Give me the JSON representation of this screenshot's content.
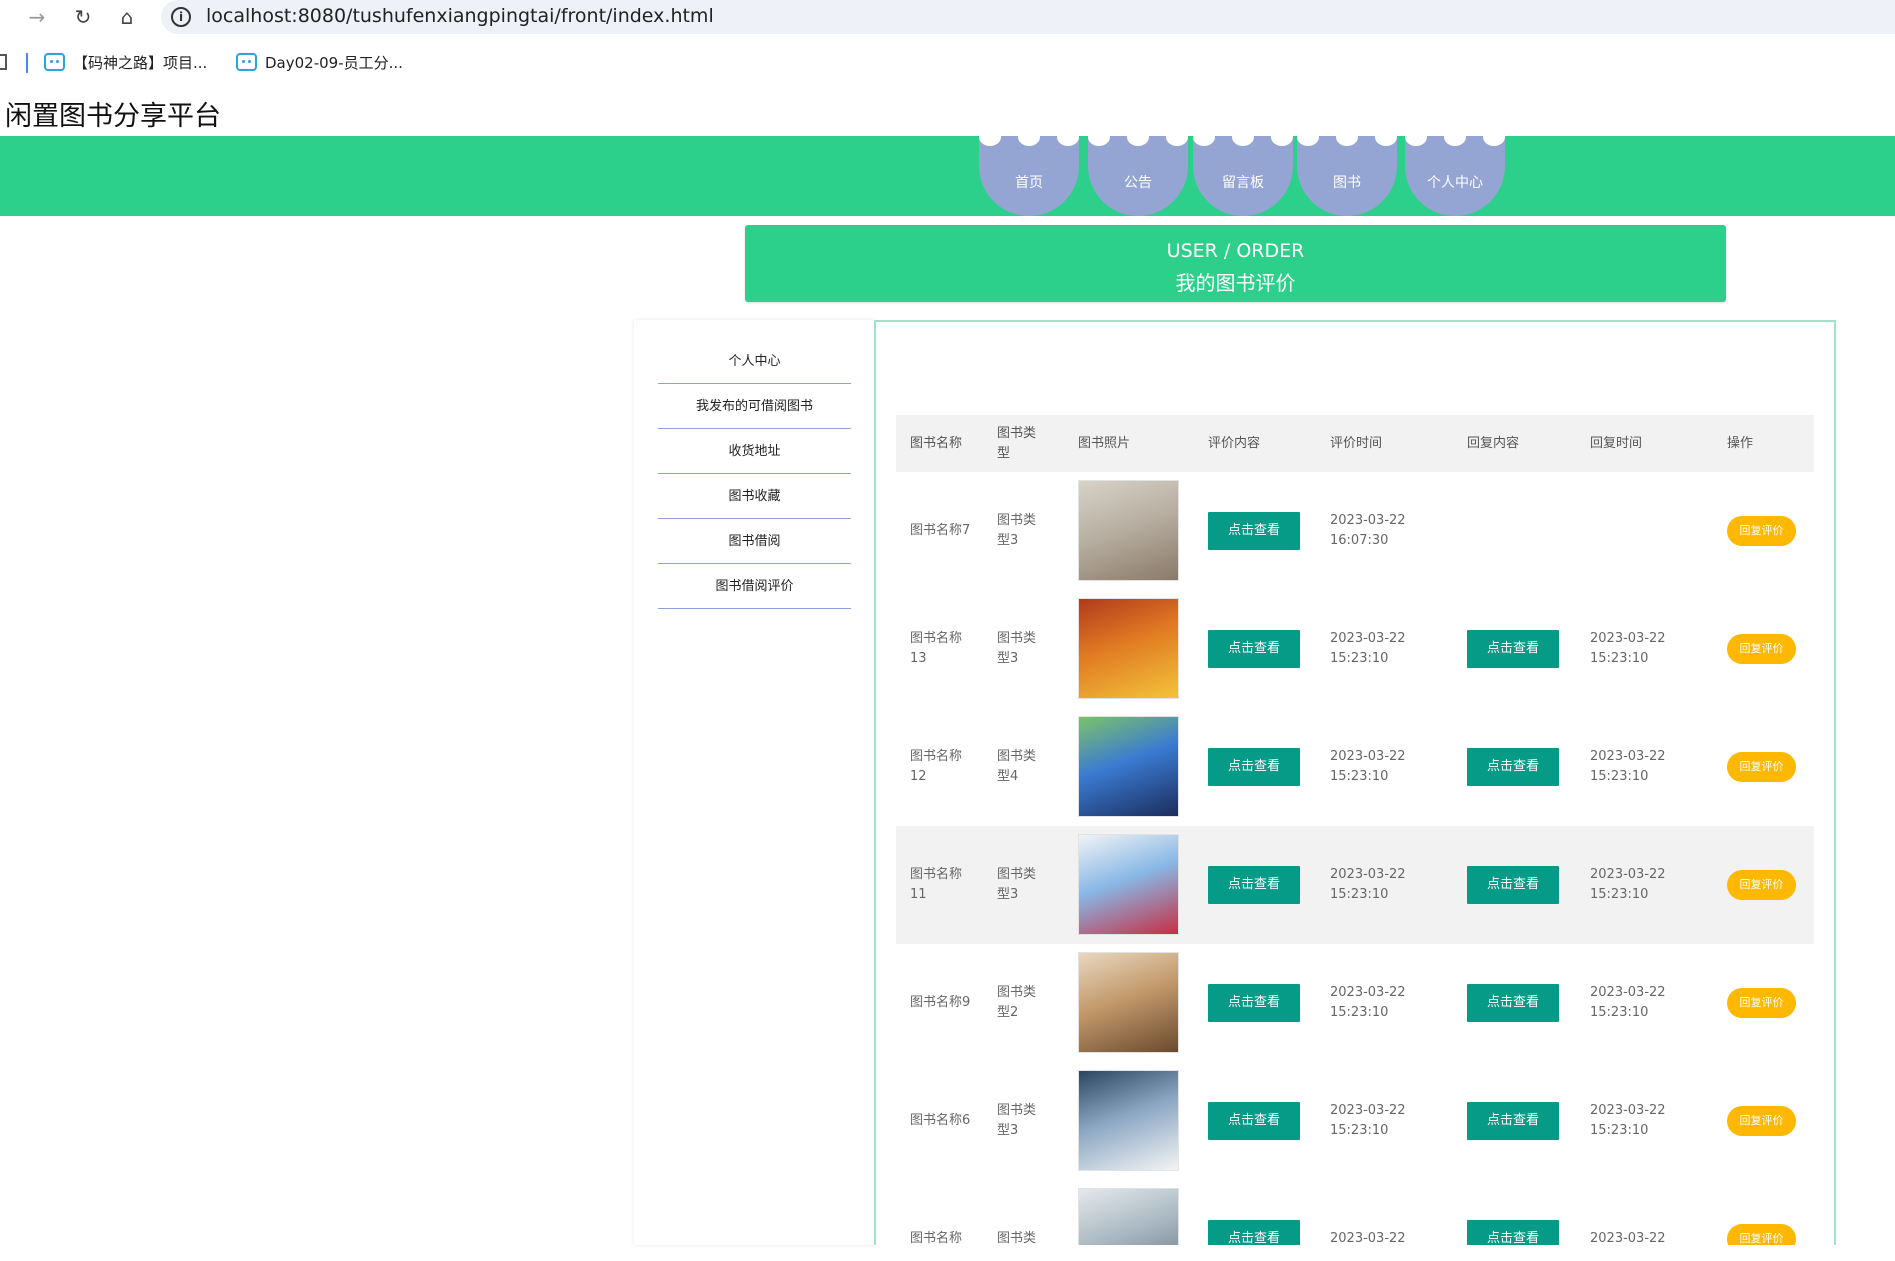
{
  "browser": {
    "url": "localhost:8080/tushufenxiangpingtai/front/index.html",
    "bookmarks": [
      {
        "label": "【码神之路】项目..."
      },
      {
        "label": "Day02-09-员工分..."
      }
    ]
  },
  "site": {
    "title": "闲置图书分享平台",
    "menu": [
      {
        "label": "首页"
      },
      {
        "label": "公告"
      },
      {
        "label": "留言板"
      },
      {
        "label": "图书"
      },
      {
        "label": "个人中心"
      }
    ],
    "banner": {
      "en": "USER / ORDER",
      "zh": "我的图书评价"
    }
  },
  "sidebar": {
    "items": [
      {
        "label": "个人中心"
      },
      {
        "label": "我发布的可借阅图书"
      },
      {
        "label": "收货地址"
      },
      {
        "label": "图书收藏"
      },
      {
        "label": "图书借阅"
      },
      {
        "label": "图书借阅评价"
      }
    ]
  },
  "table": {
    "headers": {
      "name": "图书名称",
      "type": "图书类型",
      "photo": "图书照片",
      "content": "评价内容",
      "time": "评价时间",
      "reply": "回复内容",
      "reply_time": "回复时间",
      "ops": "操作"
    },
    "view_label": "点击查看",
    "reply_label": "回复评价",
    "rows": [
      {
        "name": "图书名称7",
        "type": "图书类型3",
        "time": "2023-03-22 16:07:30",
        "reply_time": "",
        "has_reply": false,
        "highlight": false
      },
      {
        "name": "图书名称13",
        "type": "图书类型3",
        "time": "2023-03-22 15:23:10",
        "reply_time": "2023-03-22 15:23:10",
        "has_reply": true,
        "highlight": false
      },
      {
        "name": "图书名称12",
        "type": "图书类型4",
        "time": "2023-03-22 15:23:10",
        "reply_time": "2023-03-22 15:23:10",
        "has_reply": true,
        "highlight": false
      },
      {
        "name": "图书名称11",
        "type": "图书类型3",
        "time": "2023-03-22 15:23:10",
        "reply_time": "2023-03-22 15:23:10",
        "has_reply": true,
        "highlight": true
      },
      {
        "name": "图书名称9",
        "type": "图书类型2",
        "time": "2023-03-22 15:23:10",
        "reply_time": "2023-03-22 15:23:10",
        "has_reply": true,
        "highlight": false
      },
      {
        "name": "图书名称6",
        "type": "图书类型3",
        "time": "2023-03-22 15:23:10",
        "reply_time": "2023-03-22 15:23:10",
        "has_reply": true,
        "highlight": false
      },
      {
        "name": "图书名称",
        "type": "图书类",
        "time": "2023-03-22",
        "reply_time": "2023-03-22",
        "has_reply": true,
        "highlight": false
      }
    ]
  },
  "colors": {
    "accent_green": "#2dd08a",
    "menu_blue": "#94a5d4",
    "button_teal": "#069b87",
    "button_yellow": "#ffb800"
  }
}
